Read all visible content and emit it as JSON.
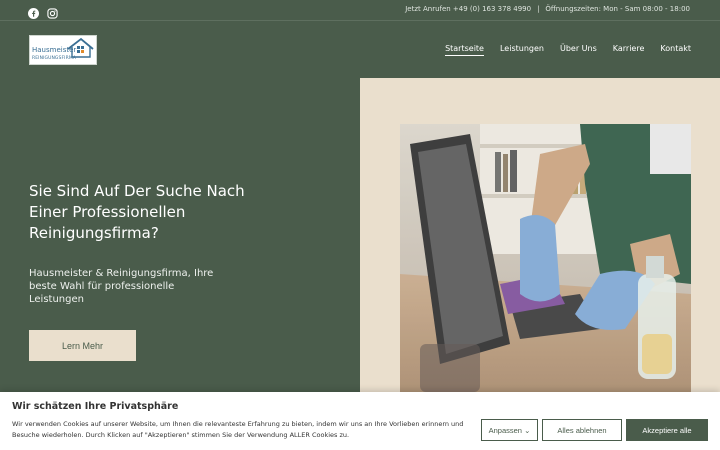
{
  "topbar": {
    "social_icons": [
      "facebook-icon",
      "instagram-icon"
    ],
    "phone": "Jetzt Anrufen +49 (0) 163 378 4990",
    "separator": "|",
    "hours": "Öffnungszeiten: Mon - Sam 08:00 - 18:00"
  },
  "logo": {
    "line1": "Hausmeister",
    "line2": "REINIGUNGSFIRMA"
  },
  "nav": {
    "items": [
      {
        "label": "Startseite"
      },
      {
        "label": "Leistungen"
      },
      {
        "label": "Über Uns"
      },
      {
        "label": "Karriere"
      },
      {
        "label": "Kontakt"
      }
    ],
    "active_index": 0
  },
  "hero": {
    "title": "Sie Sind Auf Der Suche Nach Einer Professionellen Reinigungsfirma?",
    "subtitle": "Hausmeister & Reinigungsfirma, Ihre beste Wahl für professionelle Leistungen",
    "button_label": "Lern Mehr"
  },
  "cookie": {
    "title": "Wir schätzen Ihre Privatsphäre",
    "text": "Wir verwenden Cookies auf unserer Website, um Ihnen die relevanteste Erfahrung zu bieten, indem wir uns an Ihre Vorlieben erinnern und Besuche wiederholen. Durch Klicken auf \"Akzeptieren\" stimmen Sie der Verwendung ALLER Cookies zu.",
    "adjust_label": "Anpassen ⌄",
    "reject_label": "Alles ablehnen",
    "accept_label": "Akzeptiere alle"
  },
  "colors": {
    "primary_green": "#4a5c4b",
    "beige": "#eadfcd",
    "white": "#ffffff"
  }
}
